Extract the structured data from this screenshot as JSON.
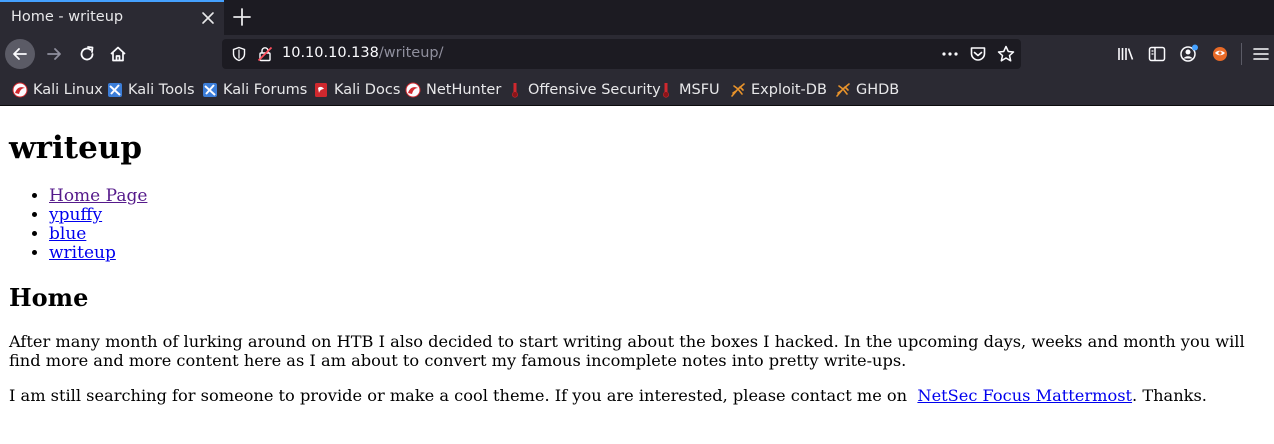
{
  "browser": {
    "tab": {
      "title": "Home - writeup"
    },
    "url": {
      "host": "10.10.10.138",
      "path": "/writeup/"
    },
    "accent": "#45a1ff",
    "bookmarks": [
      {
        "label": "Kali Linux",
        "icon": "kali-icon"
      },
      {
        "label": "Kali Tools",
        "icon": "kali-tools-icon"
      },
      {
        "label": "Kali Forums",
        "icon": "kali-forums-icon"
      },
      {
        "label": "Kali Docs",
        "icon": "kali-docs-icon"
      },
      {
        "label": "NetHunter",
        "icon": "kali-icon"
      },
      {
        "label": "Offensive Security",
        "icon": "offsec-icon"
      },
      {
        "label": "MSFU",
        "icon": "offsec-icon"
      },
      {
        "label": "Exploit-DB",
        "icon": "exploit-db-icon"
      },
      {
        "label": "GHDB",
        "icon": "exploit-db-icon"
      }
    ]
  },
  "page": {
    "title": "writeup",
    "nav": [
      "Home Page",
      "ypuffy",
      "blue",
      "writeup"
    ],
    "heading": "Home",
    "paragraph1": "After many month of lurking around on HTB I also decided to start writing about the boxes I hacked. In the upcoming days, weeks and month you will find more and more content here as I am about to convert my famous incomplete notes into pretty write-ups.",
    "paragraph2_before": "I am still searching for someone to provide or make a cool theme. If you are interested, please contact me on ",
    "paragraph2_link": "NetSec Focus Mattermost",
    "paragraph2_after": ". Thanks.",
    "colors": {
      "link": "#0000ee",
      "visited": "#551a8b"
    }
  }
}
